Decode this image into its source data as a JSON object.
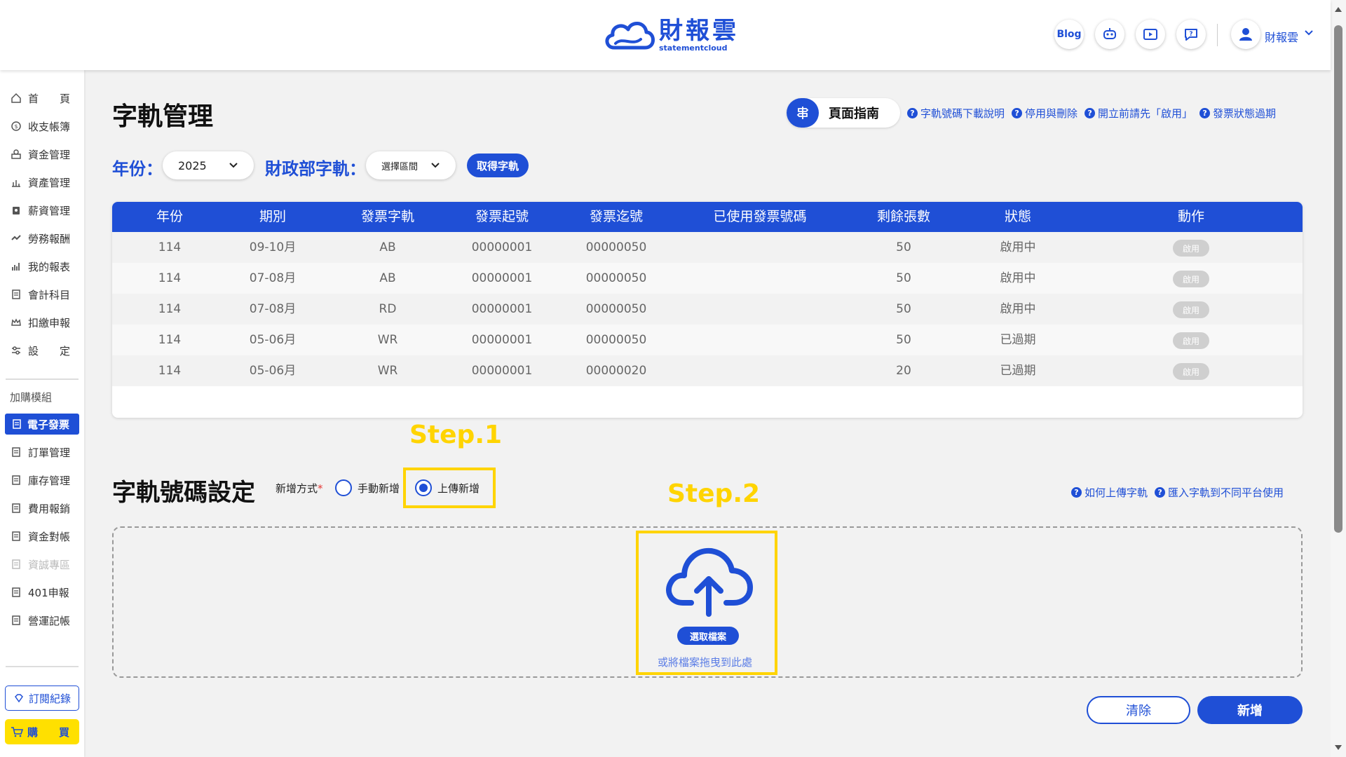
{
  "header": {
    "logo_cn": "財報雲",
    "logo_en": "statementcloud",
    "blog_label": "Blog",
    "user_name": "財報雲"
  },
  "sidebar": {
    "items": [
      {
        "label": "首　　頁",
        "icon": "home-icon"
      },
      {
        "label": "收支帳簿",
        "icon": "coin-icon"
      },
      {
        "label": "資金管理",
        "icon": "money-icon"
      },
      {
        "label": "資產管理",
        "icon": "asset-icon"
      },
      {
        "label": "薪資管理",
        "icon": "salary-icon"
      },
      {
        "label": "勞務報酬",
        "icon": "handshake-icon"
      },
      {
        "label": "我的報表",
        "icon": "bar-chart-icon"
      },
      {
        "label": "會計科目",
        "icon": "book-icon"
      },
      {
        "label": "扣繳申報",
        "icon": "crown-icon"
      },
      {
        "label": "設　　定",
        "icon": "settings-sliders-icon"
      }
    ],
    "addon_section": "加購模組",
    "addon_items": [
      {
        "label": "電子發票",
        "active": true
      },
      {
        "label": "訂單管理"
      },
      {
        "label": "庫存管理"
      },
      {
        "label": "費用報銷"
      },
      {
        "label": "資金對帳"
      },
      {
        "label": "資誠專區",
        "disabled": true
      },
      {
        "label": "401申報"
      },
      {
        "label": "營運記帳"
      }
    ],
    "subscription_label": "訂閱紀錄",
    "buy_label": "購　　買"
  },
  "page": {
    "title": "字軌管理",
    "guide_label": "頁面指南",
    "help_links": [
      "字軌號碼下載說明",
      "停用與刪除",
      "開立前請先「啟用」",
      "發票狀態過期"
    ]
  },
  "filters": {
    "year_label": "年份：",
    "year_value": "2025",
    "track_label": "財政部字軌：",
    "track_placeholder": "選擇區間",
    "get_button": "取得字軌"
  },
  "table": {
    "headers": [
      "年份",
      "期別",
      "發票字軌",
      "發票起號",
      "發票迄號",
      "已使用發票號碼",
      "剩餘張數",
      "狀態",
      "動作"
    ],
    "rows": [
      {
        "year": "114",
        "period": "09-10月",
        "track": "AB",
        "start": "00000001",
        "end": "00000050",
        "used": "",
        "remaining": "50",
        "status": "啟用中",
        "action": "啟用"
      },
      {
        "year": "114",
        "period": "07-08月",
        "track": "AB",
        "start": "00000001",
        "end": "00000050",
        "used": "",
        "remaining": "50",
        "status": "啟用中",
        "action": "啟用"
      },
      {
        "year": "114",
        "period": "07-08月",
        "track": "RD",
        "start": "00000001",
        "end": "00000050",
        "used": "",
        "remaining": "50",
        "status": "啟用中",
        "action": "啟用"
      },
      {
        "year": "114",
        "period": "05-06月",
        "track": "WR",
        "start": "00000001",
        "end": "00000050",
        "used": "",
        "remaining": "50",
        "status": "已過期",
        "action": "啟用"
      },
      {
        "year": "114",
        "period": "05-06月",
        "track": "WR",
        "start": "00000001",
        "end": "00000020",
        "used": "",
        "remaining": "20",
        "status": "已過期",
        "action": "啟用"
      }
    ]
  },
  "annotations": {
    "step1": "Step.1",
    "step2": "Step.2"
  },
  "setting": {
    "title": "字軌號碼設定",
    "mode_label": "新增方式",
    "mode_required": "*",
    "option_manual": "手動新增",
    "option_upload": "上傳新增",
    "selected": "上傳新增",
    "help_links": [
      "如何上傳字軌",
      "匯入字軌到不同平台使用"
    ],
    "choose_file": "選取檔案",
    "drop_hint": "或將檔案拖曳到此處",
    "clear_button": "清除",
    "add_button": "新增"
  },
  "colors": {
    "primary": "#1f4fd6",
    "highlight": "#ffd400",
    "buy": "#ffe000"
  }
}
